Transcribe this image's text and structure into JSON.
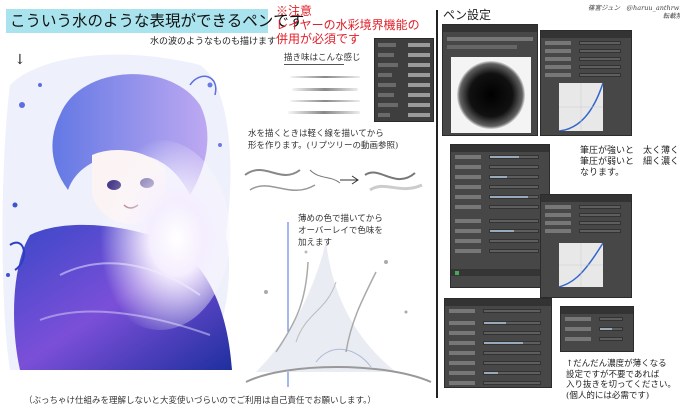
{
  "title": "こういう水のような表現ができるペンです",
  "subtitle": "水の波のようなものも描けます",
  "note": {
    "line1": "※注意",
    "line2": "レイヤーの水彩境界機能の",
    "line3": "併用が必須です"
  },
  "stroke_caption": "描き味はこんな感じ",
  "water_caption": {
    "line1": "水を描くときは軽く線を描いてから",
    "line2": "形を作ります。(リプツリーの動画参照)"
  },
  "color_caption": {
    "line1": "薄めの色で描いてから",
    "line2": "オーバーレイで色味を",
    "line3": "加えます"
  },
  "pen_settings_title": "ペン設定",
  "credit": {
    "line1": "篠宮ジュン　@haruu_anthrwrld",
    "line2": "転載禁止"
  },
  "pressure_note": {
    "line1": "筆圧が強いと　太く薄く",
    "line2": "筆圧が弱いと　細く濃く",
    "line3": "なります。"
  },
  "density_note": {
    "line1": "↑だんだん濃度が薄くなる",
    "line2": "設定ですが不要であれば",
    "line3": "入り抜きを切ってください。",
    "line4": "(個人的には必需です)"
  },
  "bottom_note": "（ぶっちゃけ仕組みを理解しないと大変使いづらいのでご利用は自己責任でお願いします。）",
  "colors": {
    "banner": "#a9e3ee",
    "warning": "#e0202a",
    "panel": "#474747"
  }
}
